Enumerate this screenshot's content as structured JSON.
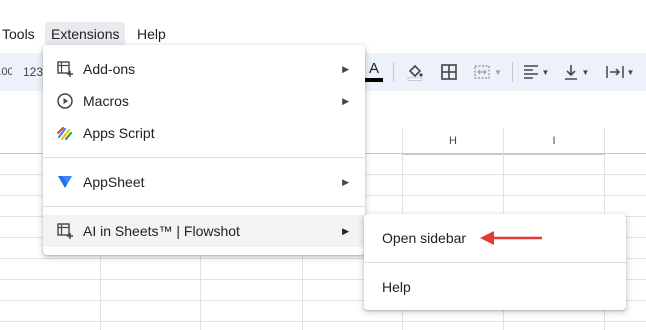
{
  "menubar": {
    "tools": "Tools",
    "extensions": "Extensions",
    "help": "Help"
  },
  "toolbar": {
    "number_format": "123",
    "text_color_letter": "A"
  },
  "columns": {
    "h": "H",
    "i": "I"
  },
  "extensions_menu": {
    "items": [
      {
        "label": "Add-ons",
        "icon": "add-ons-icon",
        "has_submenu": true
      },
      {
        "label": "Macros",
        "icon": "macros-play-icon",
        "has_submenu": true
      },
      {
        "label": "Apps Script",
        "icon": "apps-script-icon",
        "has_submenu": false
      },
      {
        "label": "AppSheet",
        "icon": "appsheet-icon",
        "has_submenu": true
      },
      {
        "label": "AI in Sheets™ | Flowshot",
        "icon": "add-on-icon",
        "has_submenu": true
      }
    ],
    "arrow": "▶"
  },
  "submenu": {
    "items": [
      {
        "label": "Open sidebar"
      },
      {
        "label": "Help"
      }
    ]
  },
  "colors": {
    "highlight": "#f1f3f4",
    "accent_arrow": "#e53935",
    "toolbar_bg": "#edf2fa"
  }
}
